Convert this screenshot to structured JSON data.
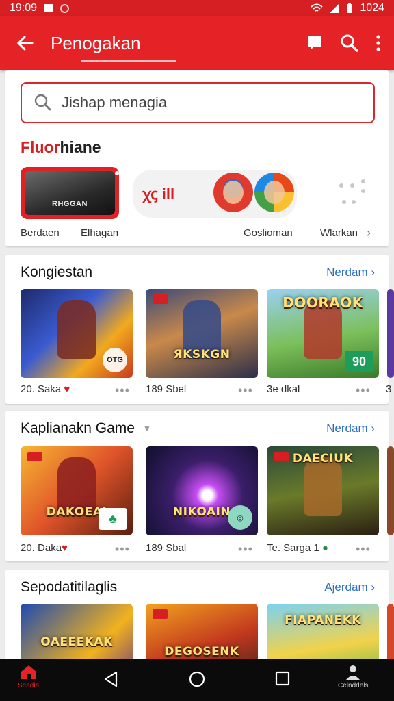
{
  "status_bar": {
    "time": "19:09",
    "battery": "1024"
  },
  "app_bar": {
    "title": "Penogakan"
  },
  "search": {
    "placeholder": "Jishap menagia"
  },
  "featured": {
    "title_red": "Fluor",
    "title_black": "hiane",
    "thumb_text": "RHGGAN",
    "pill_text": "ꭓꞔ ill",
    "labels": [
      "Berdaen",
      "Elhagan",
      "Goslioman",
      "Wlarkan"
    ]
  },
  "sections": [
    {
      "title": "Kongiestan",
      "link": "Nerdam ›",
      "tiles": [
        {
          "caption": "20. Saka",
          "suffix": "♥",
          "logo": "",
          "badge": "OTG"
        },
        {
          "caption": "189 Sbel",
          "suffix": "",
          "logo": "ЯKSKGN",
          "badge": ""
        },
        {
          "caption": "3e dkal",
          "suffix": "",
          "logo": "DOORAOK",
          "badge": "90"
        },
        {
          "caption": "3",
          "suffix": "",
          "logo": "",
          "badge": ""
        }
      ]
    },
    {
      "title": "Kaplianakn Game",
      "link": "Nerdam ›",
      "tiles": [
        {
          "caption": "20. Daka",
          "suffix": "♥",
          "logo": "DAKOEAI",
          "badge": ""
        },
        {
          "caption": "189 Sbal",
          "suffix": "",
          "logo": "NIKOAIN",
          "badge": ""
        },
        {
          "caption": "Te. Sarga 1",
          "suffix": "●",
          "logo": "DAECIUK",
          "badge": ""
        },
        {
          "caption": "",
          "suffix": "",
          "logo": "",
          "badge": ""
        }
      ]
    },
    {
      "title": "Sepodatitilaglis",
      "link": "Ajerdam ›",
      "tiles": [
        {
          "caption": "",
          "suffix": "",
          "logo": "OAEEEKAK",
          "badge": ""
        },
        {
          "caption": "",
          "suffix": "",
          "logo": "DEGOSENK",
          "badge": ""
        },
        {
          "caption": "",
          "suffix": "",
          "logo": "FIAPANEKK",
          "badge": ""
        }
      ]
    }
  ],
  "nav": {
    "home_label": "Seadia",
    "profile_label": "Celnddels"
  },
  "colors": {
    "primary": "#e52226",
    "link": "#2b6cc4"
  }
}
